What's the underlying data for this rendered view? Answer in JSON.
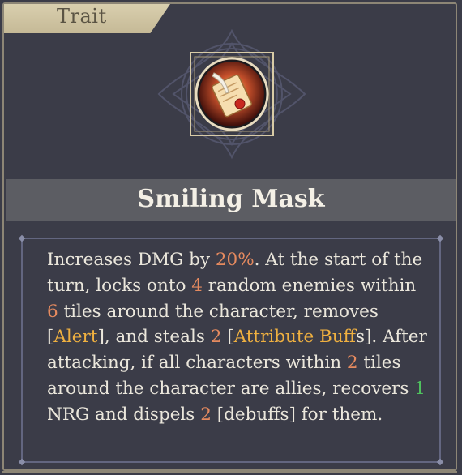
{
  "tag": {
    "label": "Trait"
  },
  "trait": {
    "name": "Smiling Mask",
    "icon": "scroll-quill-icon"
  },
  "description": [
    {
      "t": "Increases DMG by "
    },
    {
      "t": "20%",
      "hl": "o"
    },
    {
      "t": ". At the start of the turn, locks onto "
    },
    {
      "t": "4",
      "hl": "o"
    },
    {
      "t": " random enemies within "
    },
    {
      "t": "6",
      "hl": "o"
    },
    {
      "t": " tiles around the character, removes ["
    },
    {
      "t": "Alert",
      "hl": "y"
    },
    {
      "t": "], and steals "
    },
    {
      "t": "2",
      "hl": "o"
    },
    {
      "t": " ["
    },
    {
      "t": "Attribute Buff",
      "hl": "y"
    },
    {
      "t": "s]. After attacking, if all characters within "
    },
    {
      "t": "2",
      "hl": "o"
    },
    {
      "t": " tiles around the character are allies, recovers "
    },
    {
      "t": "1",
      "hl": "g"
    },
    {
      "t": " NRG and dispels "
    },
    {
      "t": "2",
      "hl": "o"
    },
    {
      "t": " [debuffs] for them."
    }
  ],
  "colors": {
    "background": "#3b3c48",
    "title_bar": "#5c5d63",
    "highlight_number": "#e58a5f",
    "highlight_keyword": "#efb040",
    "highlight_energy": "#4fc25e"
  }
}
